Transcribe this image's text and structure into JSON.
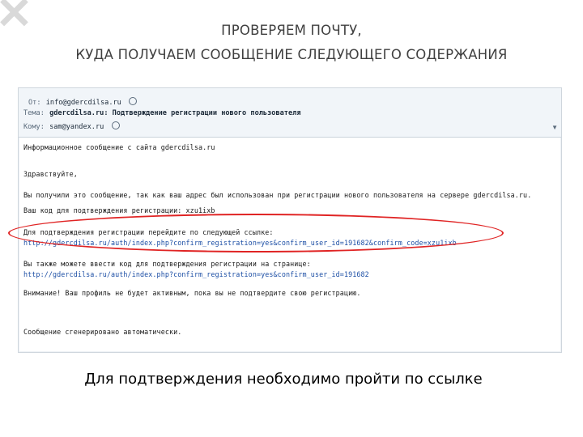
{
  "slide": {
    "title_line1": "ПРОВЕРЯЕМ ПОЧТУ,",
    "title_line2": "КУДА ПОЛУЧАЕМ СООБЩЕНИЕ СЛЕДУЮЩЕГО СОДЕРЖАНИЯ",
    "caption": "Для подтверждения необходимо пройти по ссылке"
  },
  "email": {
    "from_label": "От:",
    "from_address": "info@gdercdilsa.ru",
    "subject_label": "Тема:",
    "subject": "gdercdilsa.ru: Подтверждение регистрации нового пользователя",
    "to_label": "Кому:",
    "to_address": "sam@yandex.ru",
    "body_lines": [
      "Информационное сообщение с сайта gdercdilsa.ru",
      "Здравствуйте,",
      "Вы получили это сообщение, так как ваш адрес был использован при регистрации нового пользователя на сервере gdercdilsa.ru.",
      "Ваш код для подтверждения регистрации: xzu1ixb",
      "Для подтверждения регистрации перейдите по следующей ссылке:",
      "http://gdercdilsa.ru/auth/index.php?confirm_registration=yes&confirm_user_id=191682&confirm_code=xzu1ixb",
      "Вы также можете ввести код для подтверждения регистрации на странице:",
      "http://gdercdilsa.ru/auth/index.php?confirm_registration=yes&confirm_user_id=191682",
      "Внимание! Ваш профиль не будет активным, пока вы не подтвердите свою регистрацию.",
      "Сообщение сгенерировано автоматически."
    ]
  },
  "colors": {
    "ellipse": "#e02424",
    "link": "#1d4fa5",
    "title": "#404040"
  },
  "icons": [
    "x-mark-icon",
    "at-contact-icon",
    "scroll-down-icon"
  ]
}
